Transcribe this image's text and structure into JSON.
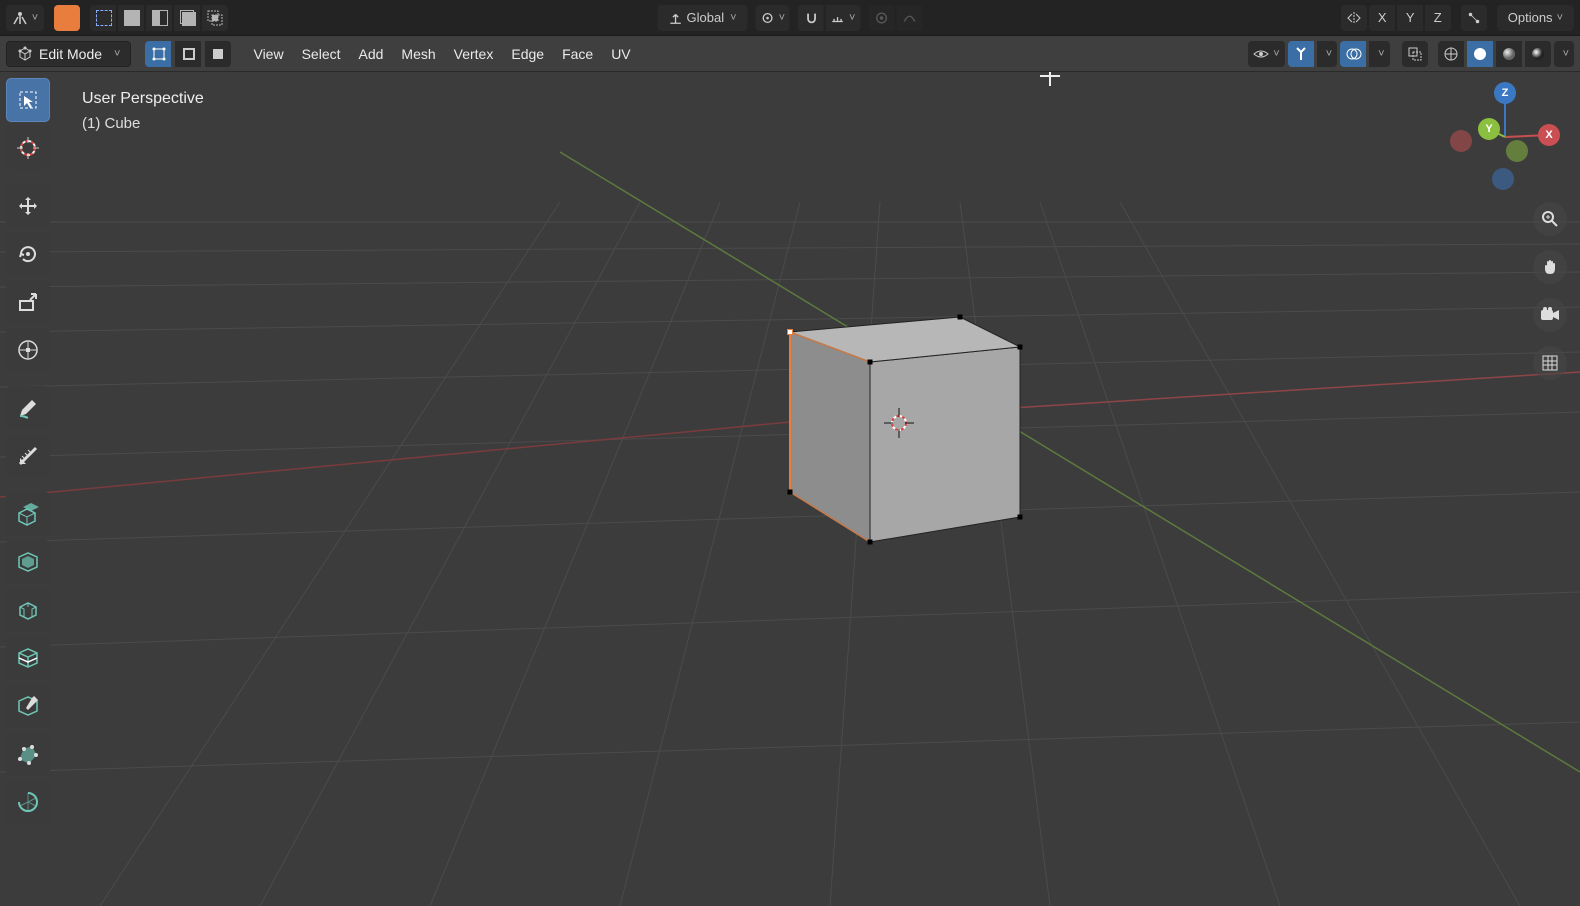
{
  "header": {
    "transform_orientation": "Global",
    "options_label": "Options",
    "mirror_axes": [
      "X",
      "Y",
      "Z"
    ]
  },
  "header2": {
    "mode_label": "Edit Mode",
    "menus": [
      "View",
      "Select",
      "Add",
      "Mesh",
      "Vertex",
      "Edge",
      "Face",
      "UV"
    ]
  },
  "overlay": {
    "line1": "User Perspective",
    "line2": "(1) Cube"
  },
  "gizmo": {
    "x": "X",
    "y": "Y",
    "z": "Z"
  },
  "tools_left": [
    "select-box",
    "cursor",
    "move",
    "rotate",
    "scale",
    "transform",
    "annotate",
    "measure",
    "extrude-region",
    "inset-faces",
    "bevel",
    "loop-cut",
    "knife",
    "poly-build",
    "spin"
  ],
  "viewport_right": [
    "zoom",
    "pan",
    "camera",
    "grid"
  ]
}
